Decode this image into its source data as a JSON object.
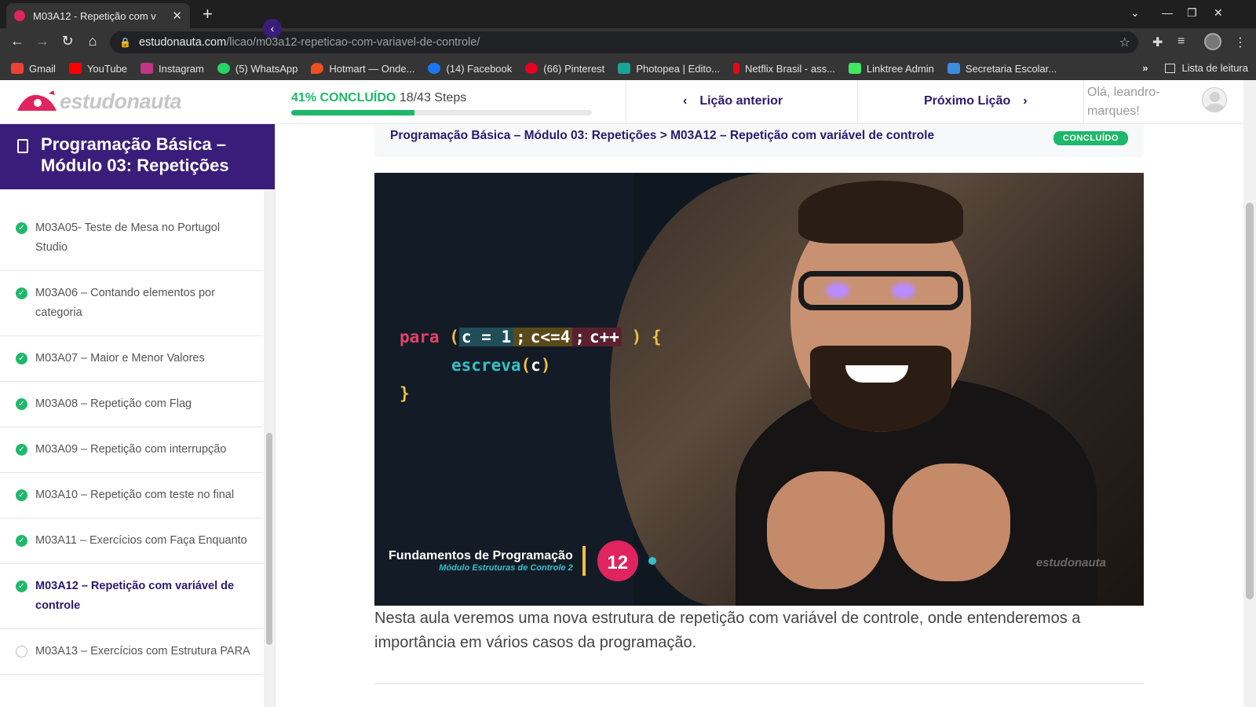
{
  "browser": {
    "tab_title": "M03A12 - Repetição com v",
    "url_host": "estudonauta.com",
    "url_path": "/licao/m03a12-repeticao-com-variavel-de-controle/",
    "bookmarks": [
      {
        "label": "Gmail",
        "color": "#ea4335"
      },
      {
        "label": "YouTube",
        "color": "#ff0000"
      },
      {
        "label": "Instagram",
        "color": "#c13584"
      },
      {
        "label": "(5) WhatsApp",
        "color": "#25d366"
      },
      {
        "label": "Hotmart — Onde...",
        "color": "#f04e23"
      },
      {
        "label": "(14) Facebook",
        "color": "#1877f2"
      },
      {
        "label": "(66) Pinterest",
        "color": "#e60023"
      },
      {
        "label": "Photopea | Edito...",
        "color": "#18a497"
      },
      {
        "label": "Netflix Brasil - ass...",
        "color": "#e50914"
      },
      {
        "label": "Linktree Admin",
        "color": "#43e660"
      },
      {
        "label": "Secretaria Escolar...",
        "color": "#3b8de0"
      }
    ],
    "more_chevron": "»",
    "reading_list": "Lista de leitura"
  },
  "header": {
    "logo_text": "estudonauta",
    "progress_pct_label": "41% CONCLUÍDO",
    "progress_steps": "18/43 Steps",
    "progress_value": 0.41,
    "prev_label": "Lição anterior",
    "next_label": "Próximo Lição",
    "greeting": "Olá, leandro-marques!"
  },
  "sidebar": {
    "course_title": "Programação Básica – Módulo 03: Repetições",
    "lessons": [
      {
        "label": "M03A05- Teste de Mesa no Portugol Studio",
        "status": "done"
      },
      {
        "label": "M03A06 – Contando elementos por categoria",
        "status": "done"
      },
      {
        "label": "M03A07 – Maior e Menor Valores",
        "status": "done"
      },
      {
        "label": "M03A08 – Repetição com Flag",
        "status": "done"
      },
      {
        "label": "M03A09 – Repetição com interrupção",
        "status": "done"
      },
      {
        "label": "M03A10 – Repetição com teste no final",
        "status": "done"
      },
      {
        "label": "M03A11 – Exercícios com Faça Enquanto",
        "status": "done"
      },
      {
        "label": "M03A12 – Repetição com variável de controle",
        "status": "active"
      },
      {
        "label": "M03A13 – Exercícios com Estrutura PARA",
        "status": "pending"
      }
    ]
  },
  "main": {
    "breadcrumb_course": "Programação Básica – Módulo 03: Repetições",
    "breadcrumb_sep": ">",
    "breadcrumb_lesson": "M03A12 – Repetição com variável de controle",
    "status_badge": "CONCLUÍDO",
    "video": {
      "code_kw": "para",
      "code_open": "(",
      "code_init": "c = 1",
      "code_sep1": ";",
      "code_cond": "c<=4",
      "code_sep2": ";",
      "code_inc": "c++",
      "code_close": ") {",
      "code_fn": "escreva",
      "code_fn_open": "(",
      "code_fn_arg": "c",
      "code_fn_close": ")",
      "code_end": "}",
      "series_title": "Fundamentos de Programação",
      "series_subtitle": "Módulo Estruturas de Controle 2",
      "episode": "12",
      "watermark": "estudonauta"
    },
    "description": "Nesta aula veremos uma nova estrutura de repetição com variável de controle, onde entenderemos a importância em vários casos da programação."
  }
}
